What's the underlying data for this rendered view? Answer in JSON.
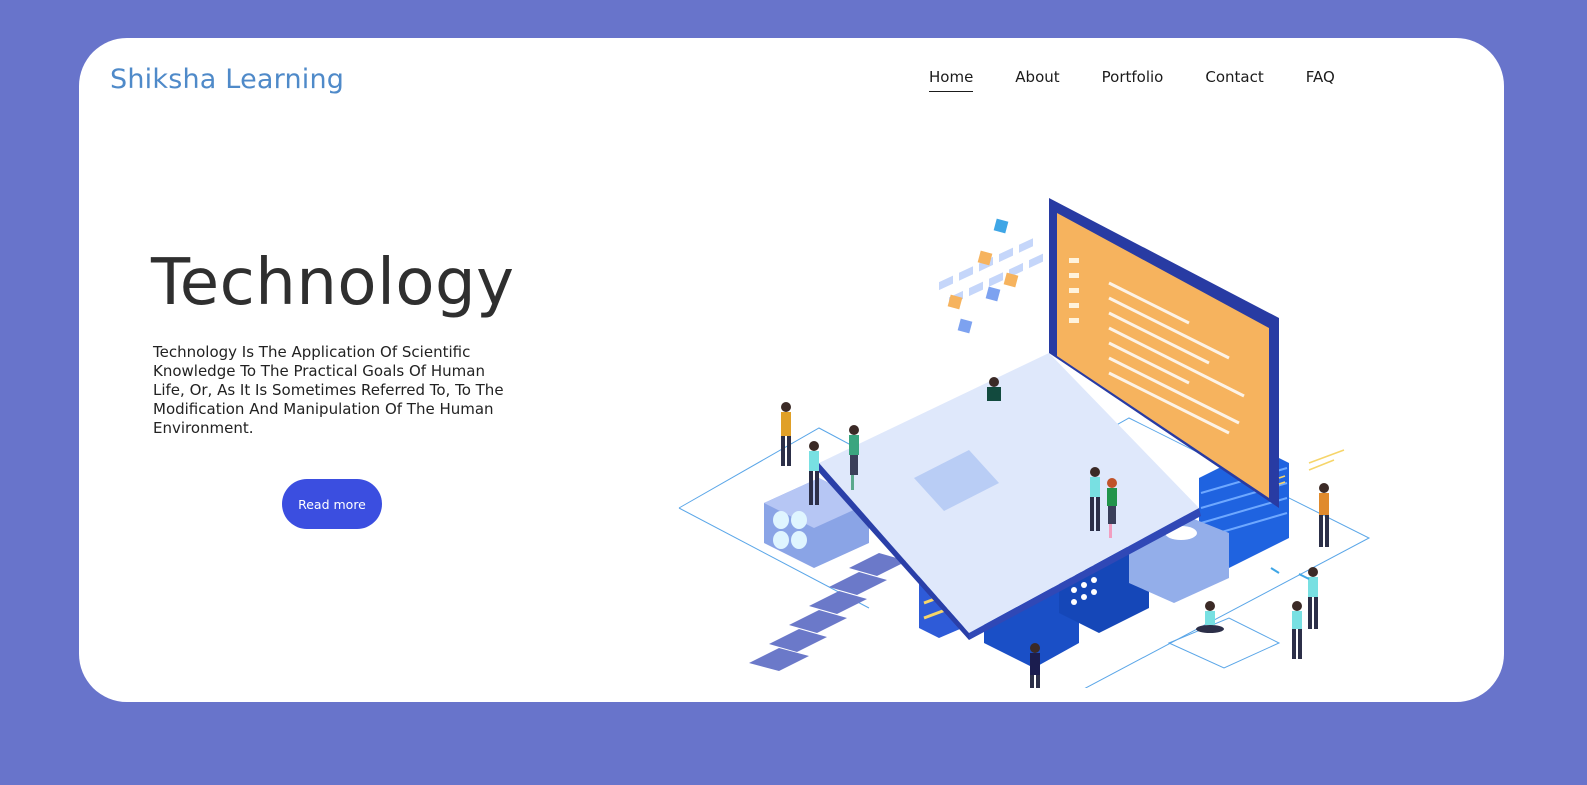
{
  "header": {
    "brand": "Shiksha Learning",
    "nav": [
      {
        "label": "Home",
        "active": true
      },
      {
        "label": "About",
        "active": false
      },
      {
        "label": "Portfolio",
        "active": false
      },
      {
        "label": "Contact",
        "active": false
      },
      {
        "label": "FAQ",
        "active": false
      }
    ]
  },
  "hero": {
    "title": "Technology",
    "description": "Technology Is The Application Of Scientific Knowledge To The Practical Goals Of Human Life, Or, As It Is Sometimes Referred To, To The Modification And Manipulation Of The Human Environment.",
    "button_label": "Read more"
  },
  "colors": {
    "page_background": "#6874cb",
    "card_background": "#ffffff",
    "brand_text": "#4f8ac9",
    "button": "#3b4ee0",
    "screen_orange": "#f6b35e"
  },
  "illustration": {
    "icon": "isometric-laptop-technology-illustration"
  }
}
